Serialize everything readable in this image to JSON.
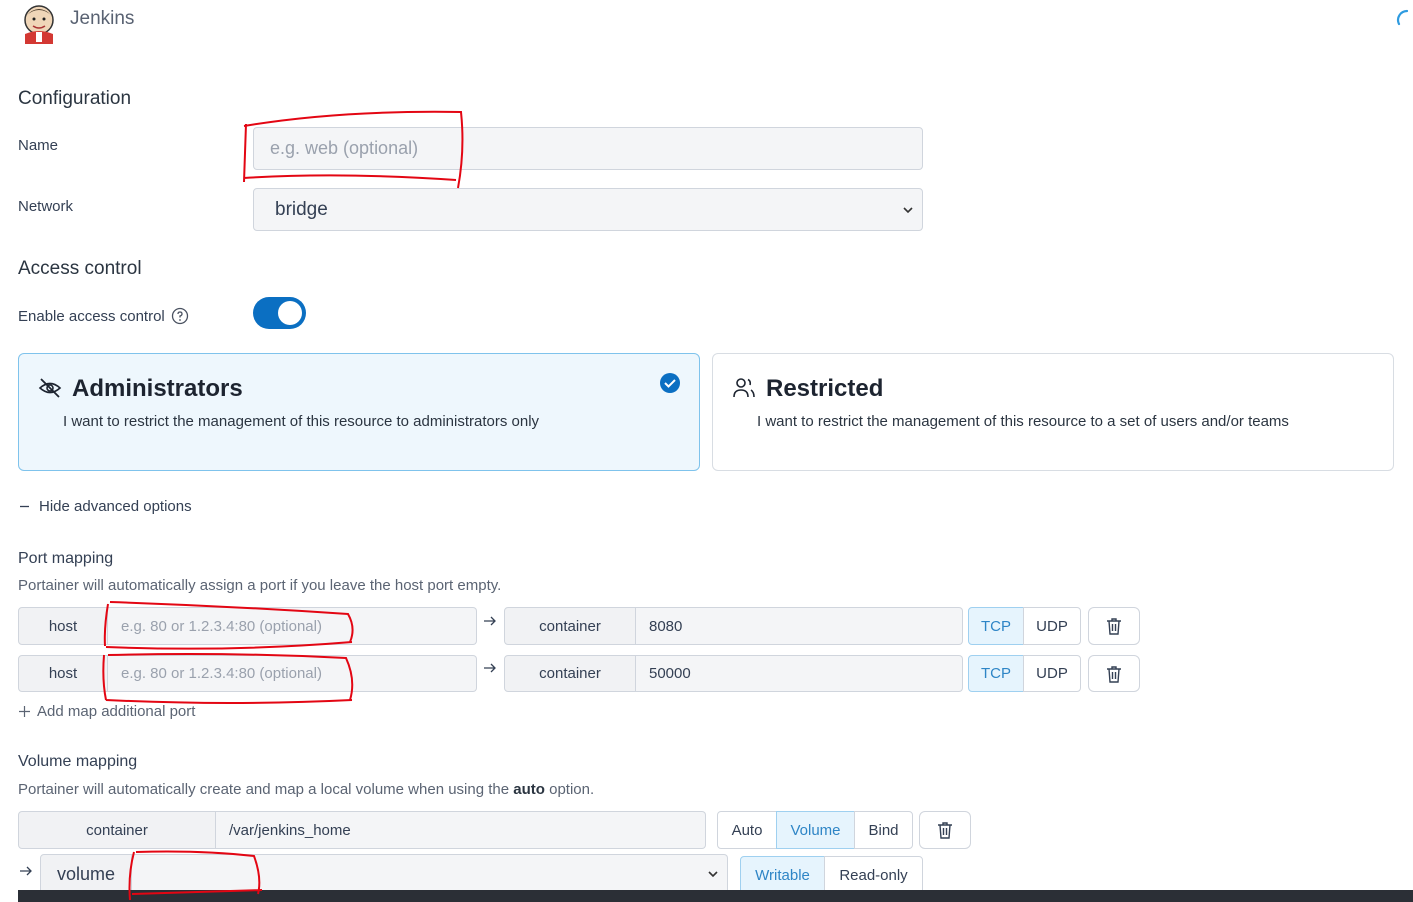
{
  "header": {
    "title": "Jenkins",
    "logo_icon": "jenkins-logo",
    "loading_icon": "loading-spinner-icon"
  },
  "configuration": {
    "section_title": "Configuration",
    "name_label": "Name",
    "name_placeholder": "e.g. web (optional)",
    "network_label": "Network",
    "network_value": "bridge"
  },
  "access_control": {
    "section_title": "Access control",
    "enable_label": "Enable access control",
    "enabled": true,
    "options": [
      {
        "title": "Administrators",
        "description": "I want to restrict the management of this resource to administrators only",
        "icon": "eye-off-icon",
        "selected": true
      },
      {
        "title": "Restricted",
        "description": "I want to restrict the management of this resource to a set of users and/or teams",
        "icon": "users-icon",
        "selected": false
      }
    ]
  },
  "advanced": {
    "toggle_label": "Hide advanced options"
  },
  "port_mapping": {
    "section_title": "Port mapping",
    "help": "Portainer will automatically assign a port if you leave the host port empty.",
    "host_label": "host",
    "host_placeholder": "e.g. 80 or 1.2.3.4:80 (optional)",
    "container_label": "container",
    "rows": [
      {
        "container_port": "8080",
        "protocol": "TCP"
      },
      {
        "container_port": "50000",
        "protocol": "TCP"
      }
    ],
    "protocol_options": [
      "TCP",
      "UDP"
    ],
    "add_label": "Add map additional port"
  },
  "volume_mapping": {
    "section_title": "Volume mapping",
    "help_before": "Portainer will automatically create and map a local volume when using the ",
    "help_bold": "auto",
    "help_after": " option.",
    "container_label": "container",
    "container_path": "/var/jenkins_home",
    "type_options": [
      "Auto",
      "Volume",
      "Bind"
    ],
    "type_selected": "Volume",
    "volume_label": "volume",
    "volume_value": "",
    "mode_options": [
      "Writable",
      "Read-only"
    ],
    "mode_selected": "Writable"
  },
  "colors": {
    "accent": "#0b6fc2",
    "selected_card_bg": "#eef7fd",
    "annotation_red": "#e30613"
  }
}
